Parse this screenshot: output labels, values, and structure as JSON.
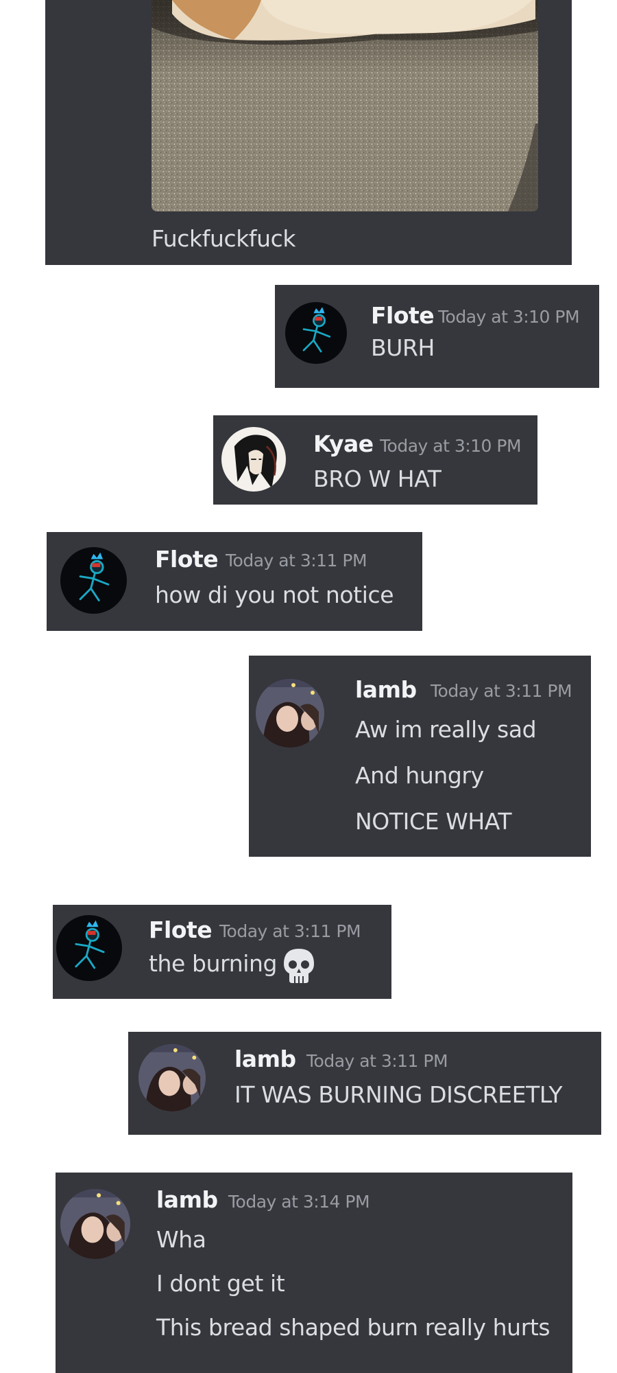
{
  "messages": [
    {
      "author": "",
      "time": "",
      "lines": [
        "Fuckfuckfuck"
      ],
      "image": "bread-photo"
    },
    {
      "author": "Flote",
      "time": "Today at 3:10 PM",
      "lines": [
        "BURH"
      ],
      "avatar": "stick-figure-avatar"
    },
    {
      "author": "Kyae",
      "time": "Today at 3:10 PM",
      "lines": [
        "BRO W HAT"
      ],
      "avatar": "anime-avatar"
    },
    {
      "author": "Flote",
      "time": "Today at 3:11 PM",
      "lines": [
        "how di you not notice"
      ],
      "avatar": "stick-figure-avatar"
    },
    {
      "author": "lamb",
      "time": "Today at 3:11 PM",
      "lines": [
        "Aw im really sad",
        "And hungry",
        "NOTICE WHAT"
      ],
      "avatar": "photo-avatar"
    },
    {
      "author": "Flote",
      "time": "Today at 3:11 PM",
      "lines": [
        "the burning"
      ],
      "emoji": "skull",
      "avatar": "stick-figure-avatar"
    },
    {
      "author": "lamb",
      "time": "Today at 3:11 PM",
      "lines": [
        "IT WAS BURNING DISCREETLY"
      ],
      "avatar": "photo-avatar"
    },
    {
      "author": "lamb",
      "time": "Today at 3:14 PM",
      "lines": [
        "Wha",
        "I dont get it",
        "This bread shaped burn really hurts"
      ],
      "avatar": "photo-avatar"
    }
  ],
  "colors": {
    "card": "#36373d",
    "username": "#f2f3f5",
    "timestamp": "#9a9ca3",
    "message": "#dbdee1"
  }
}
